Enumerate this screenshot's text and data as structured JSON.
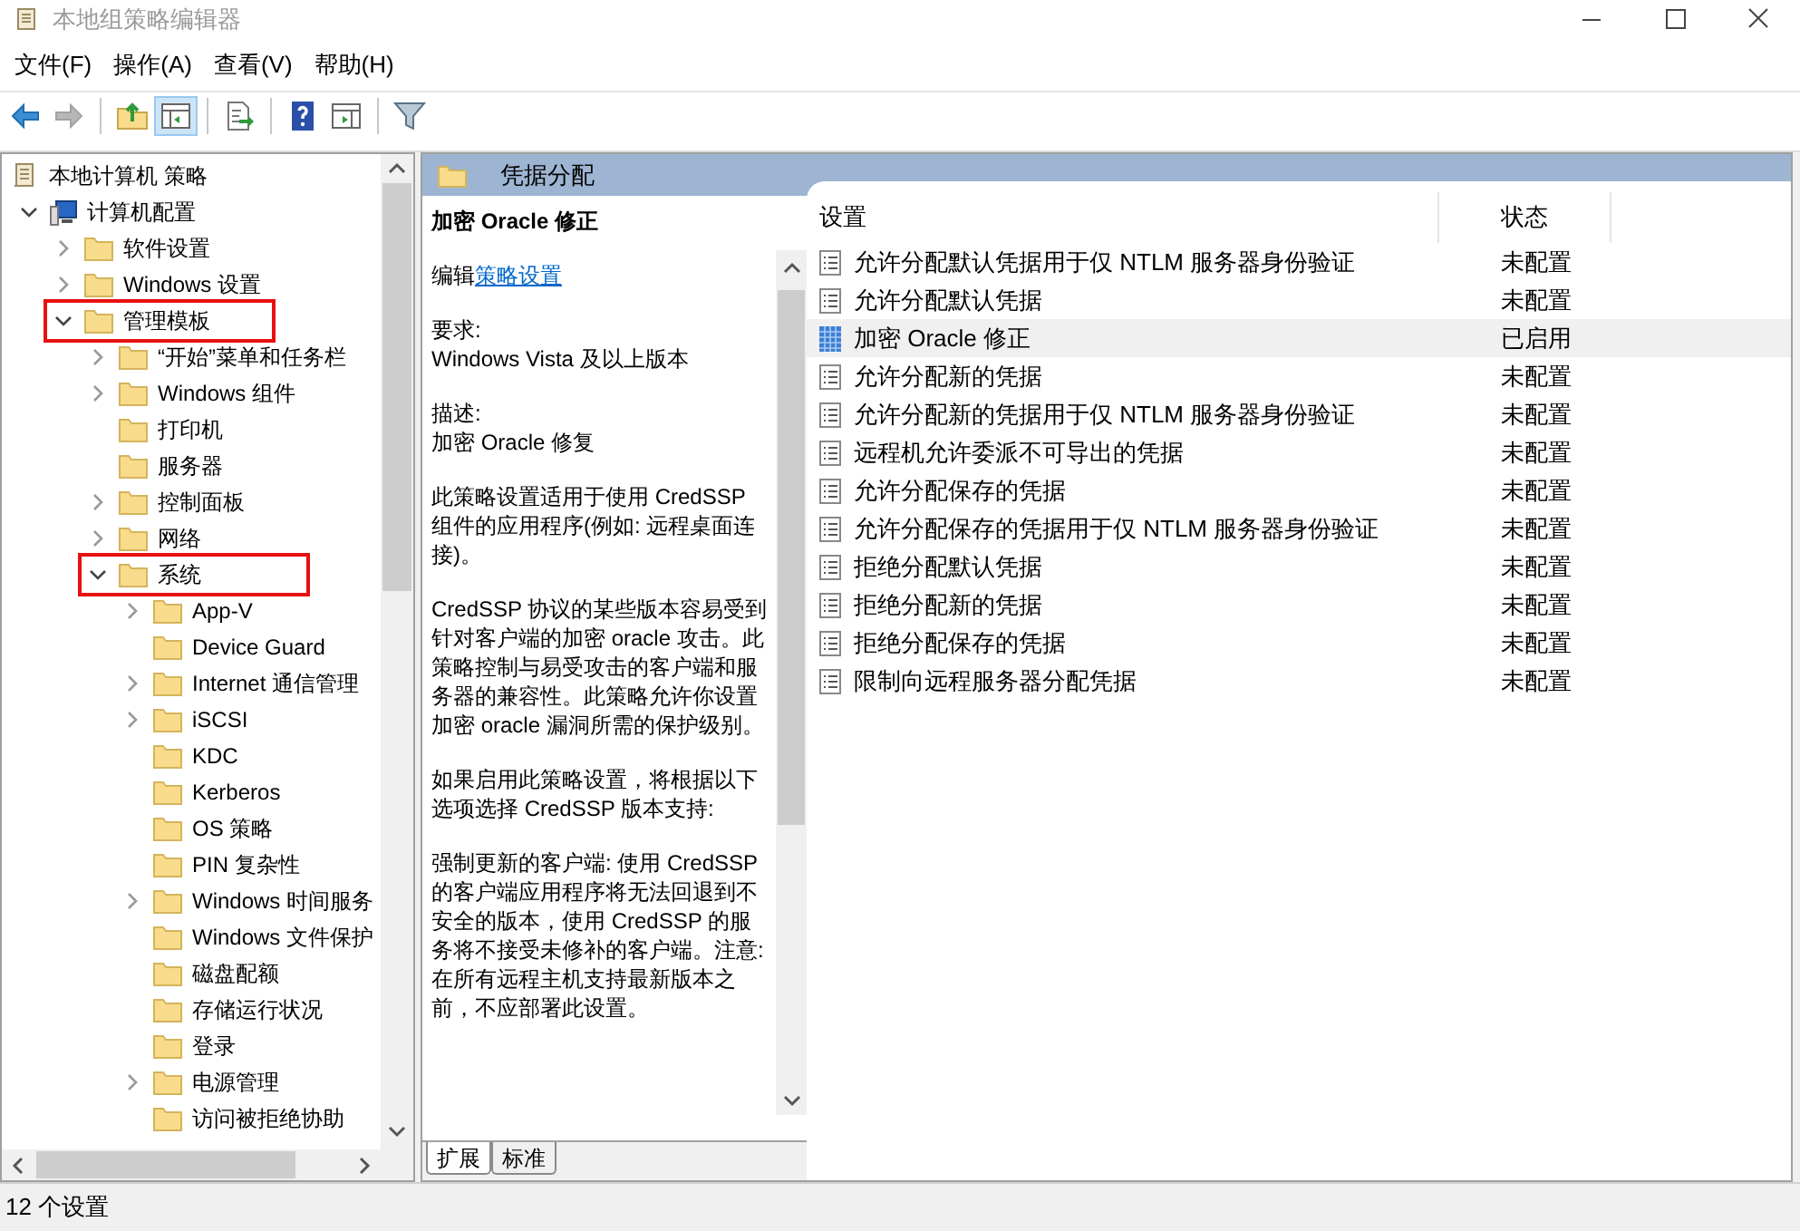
{
  "window": {
    "title": "本地组策略编辑器"
  },
  "menu": [
    "文件(F)",
    "操作(A)",
    "查看(V)",
    "帮助(H)"
  ],
  "toolbar": [
    {
      "kind": "back",
      "disabled": false,
      "pressed": false
    },
    {
      "kind": "forward",
      "disabled": true,
      "pressed": false
    },
    {
      "kind": "sep"
    },
    {
      "kind": "up",
      "disabled": false,
      "pressed": false
    },
    {
      "kind": "tree",
      "disabled": false,
      "pressed": true
    },
    {
      "kind": "sep"
    },
    {
      "kind": "export",
      "disabled": false,
      "pressed": false
    },
    {
      "kind": "sep"
    },
    {
      "kind": "help",
      "disabled": false,
      "pressed": false
    },
    {
      "kind": "pane",
      "disabled": false,
      "pressed": false
    },
    {
      "kind": "sep"
    },
    {
      "kind": "filter",
      "disabled": false,
      "pressed": false
    }
  ],
  "tree": [
    {
      "label": "本地计算机 策略",
      "kind": "root",
      "children": [
        {
          "label": "计算机配置",
          "kind": "computer",
          "expanded": true,
          "children": [
            {
              "label": "软件设置",
              "kind": "folder",
              "expanded": false
            },
            {
              "label": "Windows 设置",
              "kind": "folder",
              "expanded": false
            },
            {
              "label": "管理模板",
              "kind": "folder",
              "expanded": true,
              "highlighted": true,
              "children": [
                {
                  "label": "“开始”菜单和任务栏",
                  "kind": "folder",
                  "expanded": false
                },
                {
                  "label": "Windows 组件",
                  "kind": "folder",
                  "expanded": false
                },
                {
                  "label": "打印机",
                  "kind": "folder"
                },
                {
                  "label": "服务器",
                  "kind": "folder"
                },
                {
                  "label": "控制面板",
                  "kind": "folder",
                  "expanded": false
                },
                {
                  "label": "网络",
                  "kind": "folder",
                  "expanded": false
                },
                {
                  "label": "系统",
                  "kind": "folder",
                  "expanded": true,
                  "highlighted": true,
                  "children": [
                    {
                      "label": "App-V",
                      "kind": "folder",
                      "expanded": false
                    },
                    {
                      "label": "Device Guard",
                      "kind": "folder"
                    },
                    {
                      "label": "Internet 通信管理",
                      "kind": "folder",
                      "expanded": false
                    },
                    {
                      "label": "iSCSI",
                      "kind": "folder",
                      "expanded": false
                    },
                    {
                      "label": "KDC",
                      "kind": "folder"
                    },
                    {
                      "label": "Kerberos",
                      "kind": "folder"
                    },
                    {
                      "label": "OS 策略",
                      "kind": "folder"
                    },
                    {
                      "label": "PIN 复杂性",
                      "kind": "folder"
                    },
                    {
                      "label": "Windows 时间服务",
                      "kind": "folder",
                      "expanded": false
                    },
                    {
                      "label": "Windows 文件保护",
                      "kind": "folder"
                    },
                    {
                      "label": "磁盘配额",
                      "kind": "folder"
                    },
                    {
                      "label": "存储运行状况",
                      "kind": "folder"
                    },
                    {
                      "label": "登录",
                      "kind": "folder"
                    },
                    {
                      "label": "电源管理",
                      "kind": "folder",
                      "expanded": false
                    },
                    {
                      "label": "访问被拒绝协助",
                      "kind": "folder"
                    }
                  ]
                }
              ]
            }
          ]
        }
      ]
    }
  ],
  "header": {
    "title": "凭据分配"
  },
  "description": {
    "title": "加密 Oracle 修正",
    "edit_prefix": "编辑",
    "edit_link": "策略设置",
    "paragraphs": [
      [
        "要求:",
        "Windows Vista 及以上版本"
      ],
      [
        "描述:",
        "加密 Oracle 修复"
      ],
      [
        "此策略设置适用于使用 CredSSP 组件的应用程序(例如: 远程桌面连接)。"
      ],
      [
        "CredSSP 协议的某些版本容易受到针对客户端的加密 oracle 攻击。此策略控制与易受攻击的客户端和服务器的兼容性。此策略允许你设置加密 oracle 漏洞所需的保护级别。"
      ],
      [
        "如果启用此策略设置，将根据以下选项选择 CredSSP 版本支持:"
      ],
      [
        "强制更新的客户端: 使用 CredSSP 的客户端应用程序将无法回退到不安全的版本，使用 CredSSP 的服务将不接受未修补的客户端。注意: 在所有远程主机支持最新版本之前，不应部署此设置。"
      ]
    ]
  },
  "view_tabs": [
    {
      "label": "扩展",
      "selected": true
    },
    {
      "label": "标准",
      "selected": false
    }
  ],
  "table": {
    "columns": [
      "设置",
      "状态"
    ],
    "rows": [
      {
        "name": "允许分配默认凭据用于仅 NTLM 服务器身份验证",
        "state": "未配置",
        "selected": false
      },
      {
        "name": "允许分配默认凭据",
        "state": "未配置",
        "selected": false
      },
      {
        "name": "加密 Oracle 修正",
        "state": "已启用",
        "selected": true
      },
      {
        "name": "允许分配新的凭据",
        "state": "未配置",
        "selected": false
      },
      {
        "name": "允许分配新的凭据用于仅 NTLM 服务器身份验证",
        "state": "未配置",
        "selected": false
      },
      {
        "name": "远程机允许委派不可导出的凭据",
        "state": "未配置",
        "selected": false
      },
      {
        "name": "允许分配保存的凭据",
        "state": "未配置",
        "selected": false
      },
      {
        "name": "允许分配保存的凭据用于仅 NTLM 服务器身份验证",
        "state": "未配置",
        "selected": false
      },
      {
        "name": "拒绝分配默认凭据",
        "state": "未配置",
        "selected": false
      },
      {
        "name": "拒绝分配新的凭据",
        "state": "未配置",
        "selected": false
      },
      {
        "name": "拒绝分配保存的凭据",
        "state": "未配置",
        "selected": false
      },
      {
        "name": "限制向远程服务器分配凭据",
        "state": "未配置",
        "selected": false
      }
    ]
  },
  "status_bar": "12 个设置"
}
